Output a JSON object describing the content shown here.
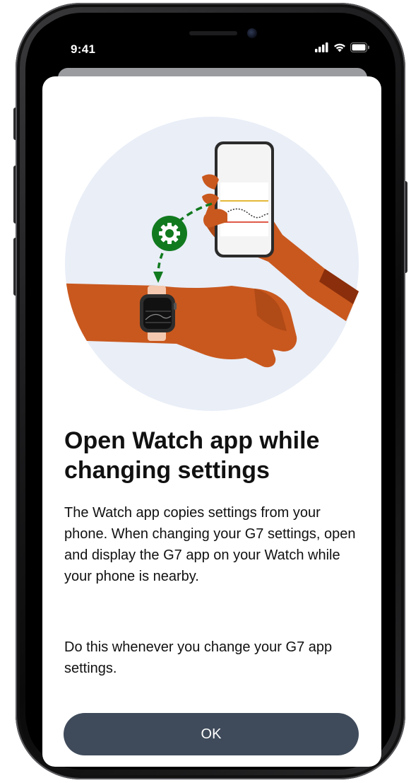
{
  "status_bar": {
    "time": "9:41",
    "signal_icon": "cellular-signal-icon",
    "wifi_icon": "wifi-icon",
    "battery_icon": "battery-icon"
  },
  "illustration": {
    "name": "watch-and-phone-sync-illustration",
    "background_color": "#e9eef7",
    "skin_color": "#c9581e",
    "accent_green": "#117a1f"
  },
  "modal": {
    "title": "Open Watch app while changing settings",
    "paragraph_1": "The Watch app copies settings from your phone. When changing your G7 settings, open and display the G7 app on your Watch while your phone is nearby.",
    "paragraph_2": "Do this whenever you change your G7 app settings.",
    "ok_label": "OK",
    "button_color": "#3f4b5b"
  }
}
